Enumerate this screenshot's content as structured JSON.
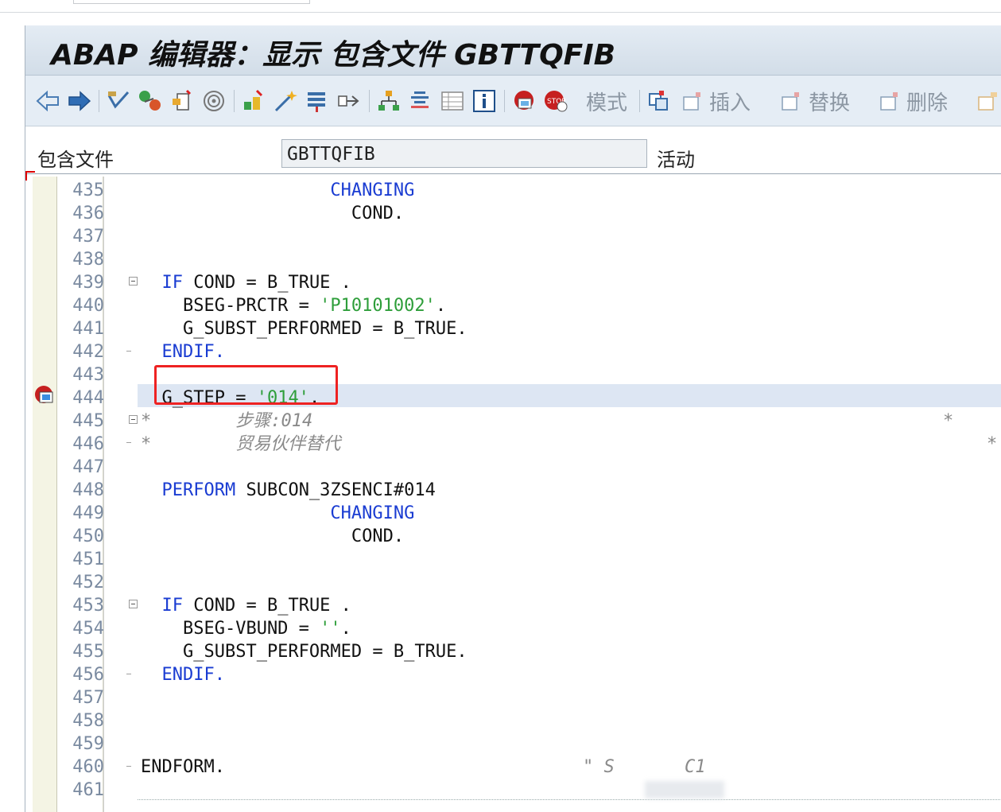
{
  "window": {
    "title": "ABAP 编辑器：显示 包含文件 GBTTQFIB"
  },
  "toolbar": {
    "mode_label": "模式",
    "insert_label": "插入",
    "replace_label": "替换",
    "delete_label": "删除"
  },
  "header": {
    "include_label": "包含文件",
    "include_value": "GBTTQFIB",
    "status": "活动"
  },
  "editor": {
    "lines": [
      {
        "no": "435",
        "text": "CHANGING",
        "indent": "                  ",
        "cls": "kw"
      },
      {
        "no": "436",
        "text": "COND.",
        "indent": "                    ",
        "cls": ""
      },
      {
        "no": "437",
        "text": "",
        "indent": "",
        "cls": ""
      },
      {
        "no": "438",
        "text": "",
        "indent": "",
        "cls": ""
      },
      {
        "no": "439",
        "text": "IF COND = B_TRUE .",
        "indent": "  ",
        "cls": "if"
      },
      {
        "no": "440",
        "text": "BSEG-PRCTR = 'P10101002'.",
        "indent": "    ",
        "cls": "assign_str"
      },
      {
        "no": "441",
        "text": "G_SUBST_PERFORMED = B_TRUE.",
        "indent": "    ",
        "cls": ""
      },
      {
        "no": "442",
        "text": "ENDIF.",
        "indent": "  ",
        "cls": "kw"
      },
      {
        "no": "443",
        "text": "",
        "indent": "",
        "cls": ""
      },
      {
        "no": "444",
        "text": "G_STEP = '014'.",
        "indent": "  ",
        "cls": "assign_str"
      },
      {
        "no": "445",
        "text": "*        步骤:014",
        "indent": "",
        "cls": "cmt"
      },
      {
        "no": "446",
        "text": "*        贸易伙伴替代",
        "indent": "",
        "cls": "cmt"
      },
      {
        "no": "447",
        "text": "",
        "indent": "",
        "cls": ""
      },
      {
        "no": "448",
        "text": "PERFORM SUBCON_3ZSENCI#014",
        "indent": "  ",
        "cls": "perform"
      },
      {
        "no": "449",
        "text": "CHANGING",
        "indent": "                  ",
        "cls": "kw"
      },
      {
        "no": "450",
        "text": "COND.",
        "indent": "                    ",
        "cls": ""
      },
      {
        "no": "451",
        "text": "",
        "indent": "",
        "cls": ""
      },
      {
        "no": "452",
        "text": "",
        "indent": "",
        "cls": ""
      },
      {
        "no": "453",
        "text": "IF COND = B_TRUE .",
        "indent": "  ",
        "cls": "if"
      },
      {
        "no": "454",
        "text": "BSEG-VBUND = ''.",
        "indent": "    ",
        "cls": "assign_str"
      },
      {
        "no": "455",
        "text": "G_SUBST_PERFORMED = B_TRUE.",
        "indent": "    ",
        "cls": ""
      },
      {
        "no": "456",
        "text": "ENDIF.",
        "indent": "  ",
        "cls": "kw"
      },
      {
        "no": "457",
        "text": "",
        "indent": "",
        "cls": ""
      },
      {
        "no": "458",
        "text": "",
        "indent": "",
        "cls": ""
      },
      {
        "no": "459",
        "text": "",
        "indent": "",
        "cls": ""
      },
      {
        "no": "460",
        "text": "ENDFORM.",
        "indent": "",
        "cls": "endform"
      },
      {
        "no": "461",
        "text": "",
        "indent": "",
        "cls": ""
      }
    ],
    "endform_comment": "\" S",
    "endform_comment_tail": "C1"
  },
  "colors": {
    "keyword": "#1a3cd2",
    "string": "#2e9e3a",
    "comment": "#8a8a8a",
    "highlight": "#dde6f3",
    "annotation_box": "#ee2222"
  }
}
